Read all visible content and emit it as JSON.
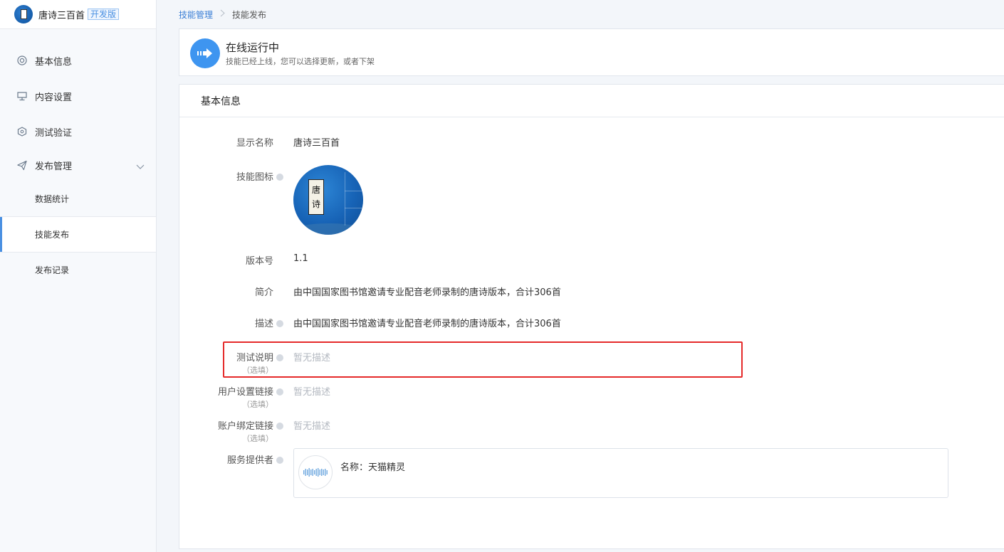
{
  "app": {
    "name": "唐诗三百首",
    "env_tag": "开发版"
  },
  "sidebar": {
    "items": [
      {
        "label": "基本信息",
        "icon": "lifebuoy-icon"
      },
      {
        "label": "内容设置",
        "icon": "display-icon"
      },
      {
        "label": "测试验证",
        "icon": "hexagon-icon"
      },
      {
        "label": "发布管理",
        "icon": "paper-plane-icon",
        "expanded": true,
        "children": [
          {
            "label": "数据统计"
          },
          {
            "label": "技能发布",
            "active": true
          },
          {
            "label": "发布记录"
          }
        ]
      }
    ]
  },
  "breadcrumb": {
    "parent": "技能管理",
    "current": "技能发布"
  },
  "status": {
    "title": "在线运行中",
    "subtitle": "技能已经上线，您可以选择更新，或者下架",
    "icon": "arrow-right-icon"
  },
  "info": {
    "heading": "基本信息",
    "display_name_label": "显示名称",
    "display_name": "唐诗三百首",
    "skill_icon_label": "技能图标",
    "skill_icon_text": [
      "唐",
      "诗"
    ],
    "version_label": "版本号",
    "version": "1.1",
    "intro_label": "简介",
    "intro": "由中国国家图书馆邀请专业配音老师录制的唐诗版本，合计306首",
    "desc_label": "描述",
    "desc": "由中国国家图书馆邀请专业配音老师录制的唐诗版本，合计306首",
    "test_label": "测试说明",
    "test_optional": "（选填）",
    "test_value": "暂无描述",
    "user_link_label": "用户设置链接",
    "user_link_optional": "（选填）",
    "user_link_value": "暂无描述",
    "account_link_label": "账户绑定链接",
    "account_link_optional": "（选填）",
    "account_link_value": "暂无描述",
    "provider_label": "服务提供者",
    "provider_name": "名称：天猫精灵"
  },
  "colors": {
    "accent": "#4a90e2",
    "highlight": "#e52a2a",
    "status_icon": "#3e95f0"
  }
}
